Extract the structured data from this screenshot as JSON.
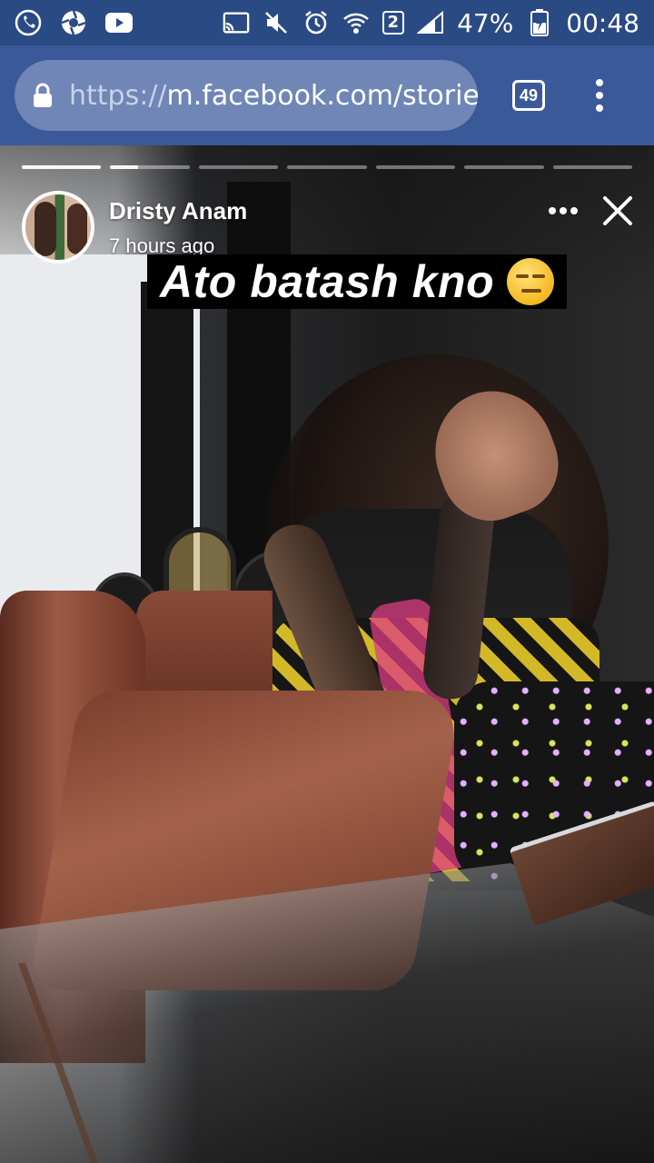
{
  "status_bar": {
    "battery": "47%",
    "time": "00:48",
    "sim_slot": "2",
    "icons": [
      "phone-icon",
      "shutter-icon",
      "youtube-icon",
      "cast-icon",
      "mute-icon",
      "alarm-icon",
      "wifi-icon",
      "sim-icon",
      "signal-icon",
      "battery-icon"
    ]
  },
  "browser": {
    "url_scheme": "https://",
    "url_rest": "m.facebook.com/storie",
    "tab_count": "49",
    "accent": "#3b5998"
  },
  "story": {
    "progress": {
      "segments": 7,
      "completed": 1,
      "current_fraction": 0.35
    },
    "author_name": "Dristy Anam",
    "posted_time": "7 hours ago",
    "caption": "Ato batash kno",
    "caption_emoji": "expressionless-face-icon"
  }
}
